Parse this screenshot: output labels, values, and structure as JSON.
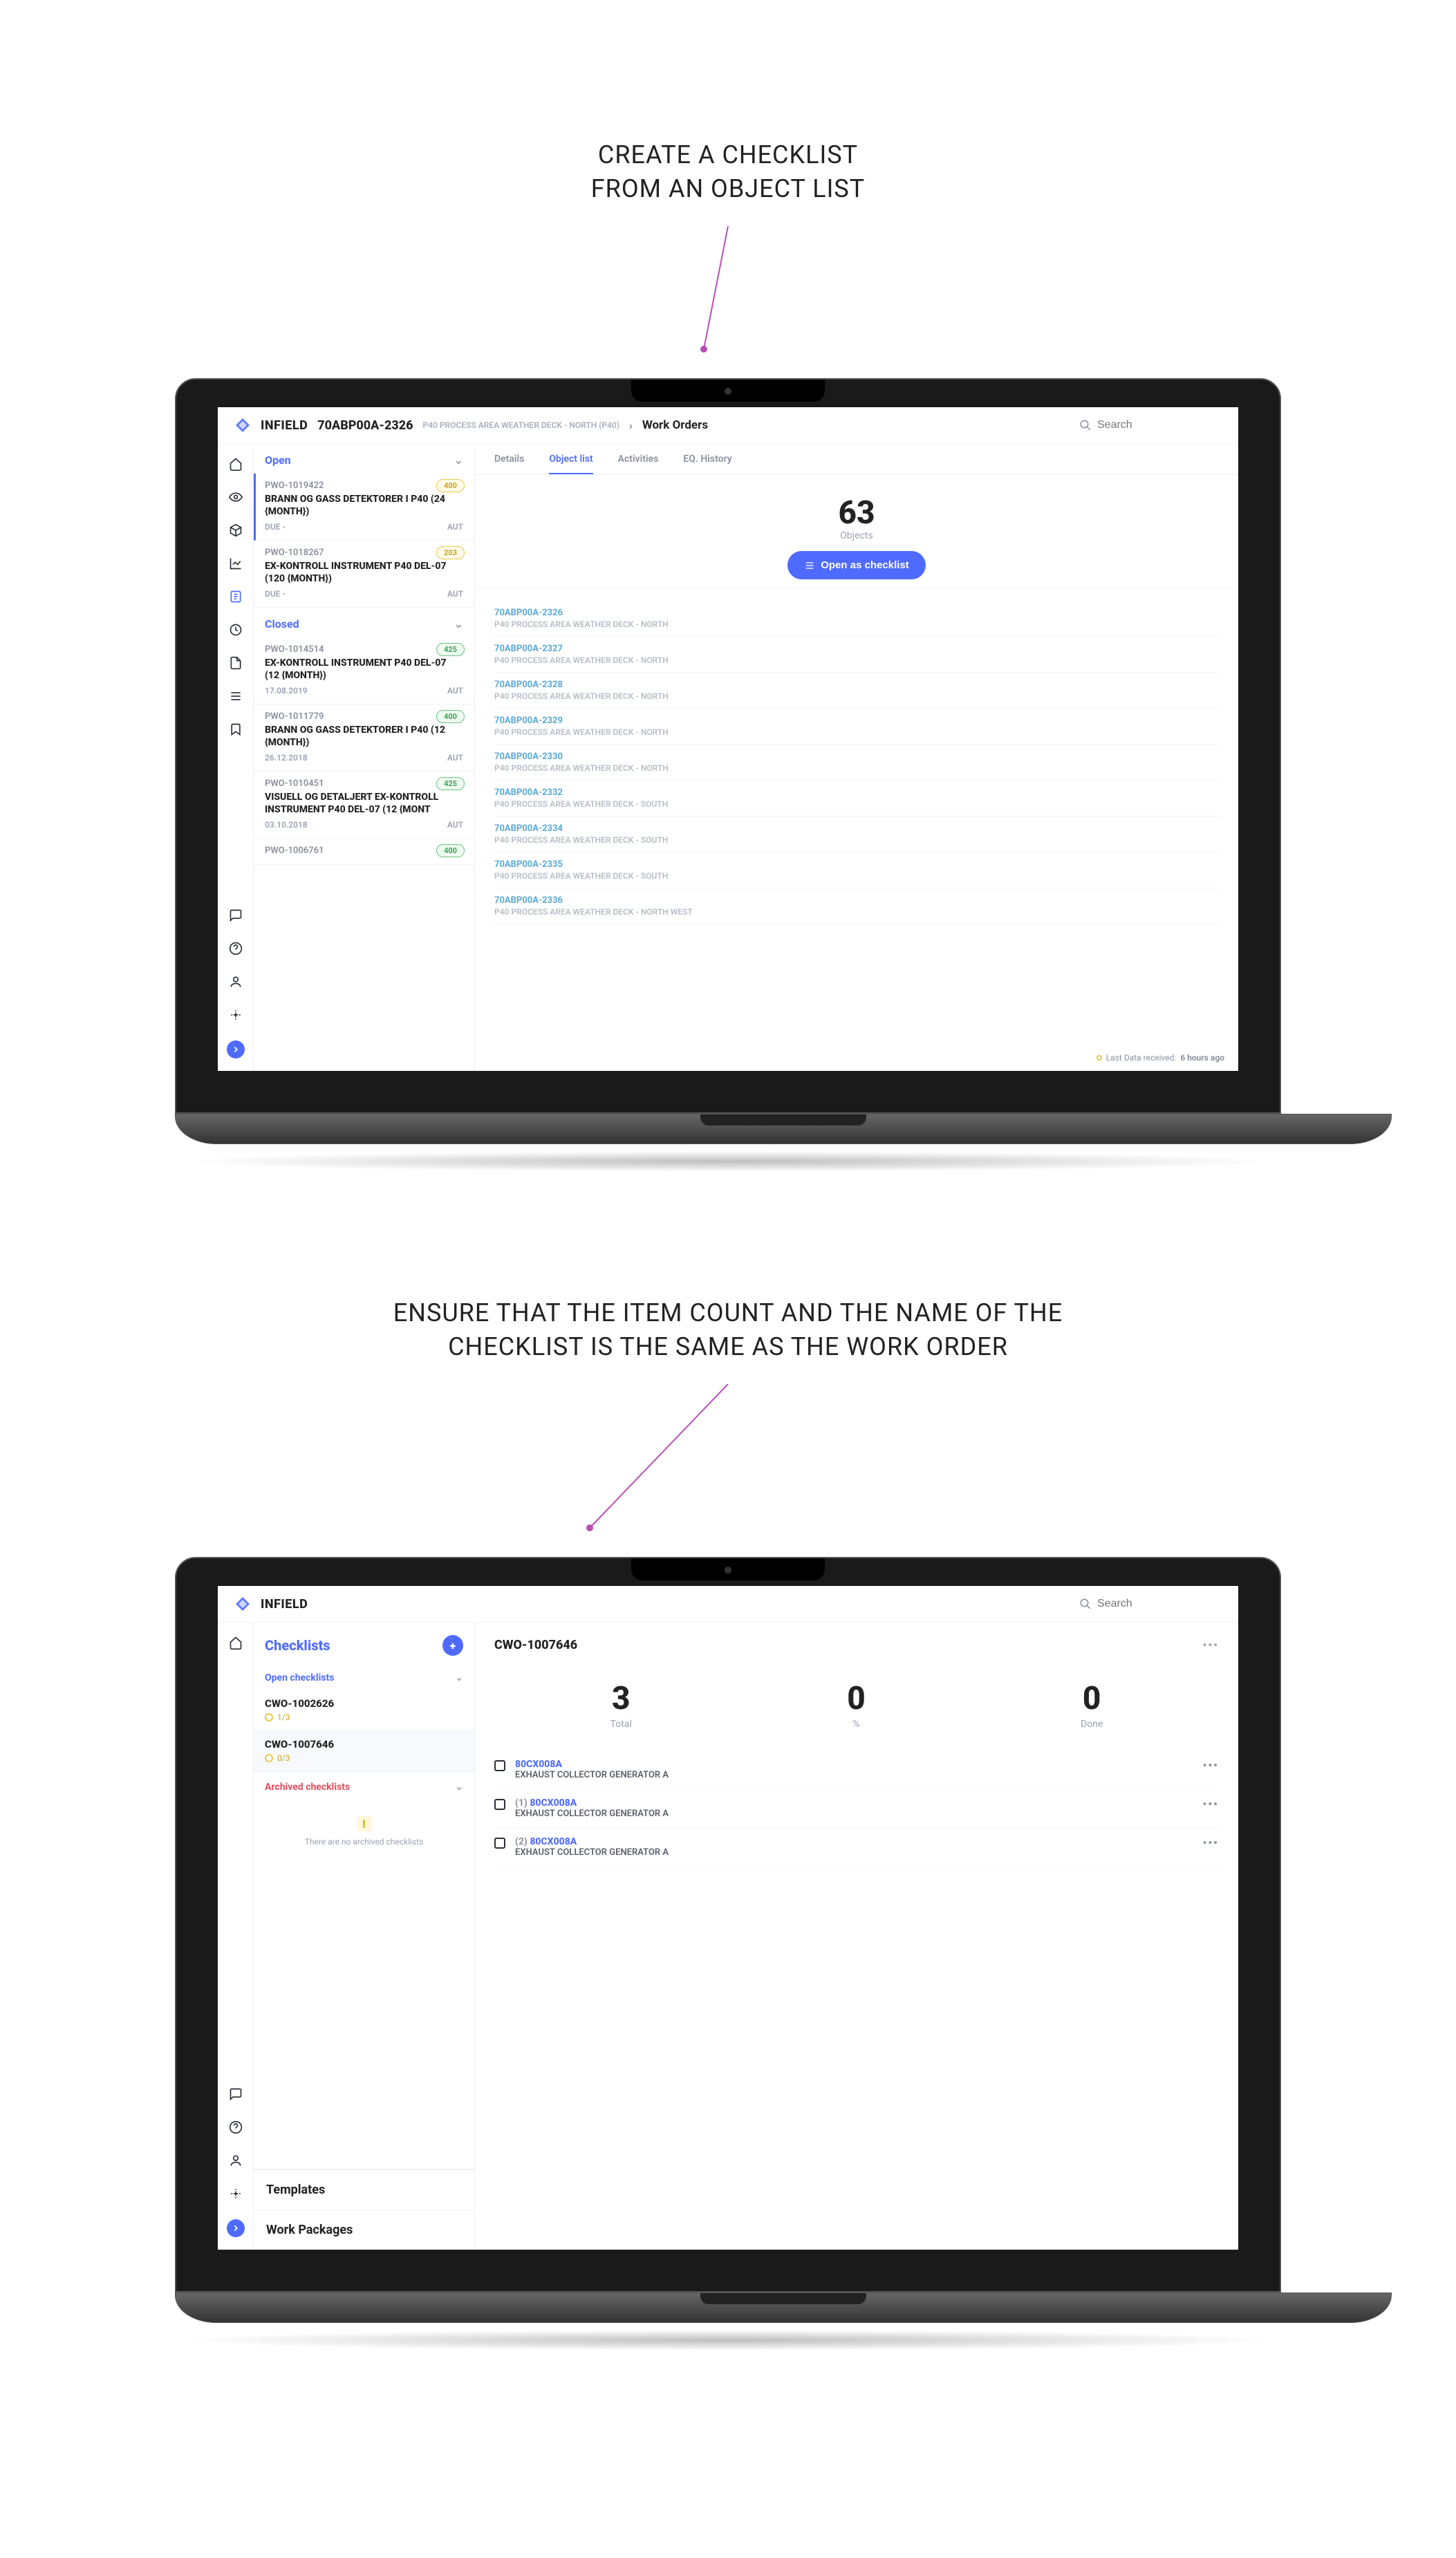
{
  "annotation1": {
    "line1": "CREATE A CHECKLIST",
    "line2": "FROM AN OBJECT LIST"
  },
  "annotation2": {
    "line1": "ENSURE THAT THE ITEM COUNT AND THE NAME OF THE",
    "line2": "CHECKLIST IS THE SAME AS THE WORK ORDER"
  },
  "screen1": {
    "brand": "INFIELD",
    "breadcrumb": {
      "id": "70ABP00A-2326",
      "sub": "P40 PROCESS AREA WEATHER DECK - NORTH (P40)",
      "last": "Work Orders"
    },
    "search_placeholder": "Search",
    "tabs": [
      "Details",
      "Object list",
      "Activities",
      "EQ. History"
    ],
    "active_tab": 1,
    "sections": {
      "open": "Open",
      "closed": "Closed"
    },
    "work_orders_open": [
      {
        "id": "PWO-1019422",
        "title": "BRANN OG GASS DETEKTORER I P40 (24 {MONTH})",
        "due": "DUE -",
        "disc": "AUT",
        "badge": "400",
        "badge_color": "yellow",
        "active": true
      },
      {
        "id": "PWO-1018267",
        "title": "EX-KONTROLL INSTRUMENT P40 DEL-07 (120 {MONTH})",
        "due": "DUE -",
        "disc": "AUT",
        "badge": "203",
        "badge_color": "yellow"
      }
    ],
    "work_orders_closed": [
      {
        "id": "PWO-1014514",
        "title": "EX-KONTROLL INSTRUMENT P40 DEL-07 (12 {MONTH})",
        "due": "17.08.2019",
        "disc": "AUT",
        "badge": "425",
        "badge_color": "green"
      },
      {
        "id": "PWO-1011779",
        "title": "BRANN OG GASS DETEKTORER I P40 (12 {MONTH})",
        "due": "26.12.2018",
        "disc": "AUT",
        "badge": "400",
        "badge_color": "green"
      },
      {
        "id": "PWO-1010451",
        "title": "VISUELL OG DETALJERT EX-KONTROLL INSTRUMENT P40 DEL-07 (12 {MONT",
        "due": "03.10.2018",
        "disc": "AUT",
        "badge": "425",
        "badge_color": "green"
      },
      {
        "id": "PWO-1006761",
        "title": "",
        "due": "",
        "disc": "",
        "badge": "400",
        "badge_color": "green"
      }
    ],
    "object_count": "63",
    "object_label": "Objects",
    "open_checklist_btn": "Open as checklist",
    "objects": [
      {
        "id": "70ABP00A-2326",
        "desc": "P40 PROCESS AREA WEATHER DECK - NORTH"
      },
      {
        "id": "70ABP00A-2327",
        "desc": "P40 PROCESS AREA WEATHER DECK - NORTH"
      },
      {
        "id": "70ABP00A-2328",
        "desc": "P40 PROCESS AREA WEATHER DECK - NORTH"
      },
      {
        "id": "70ABP00A-2329",
        "desc": "P40 PROCESS AREA WEATHER DECK - NORTH"
      },
      {
        "id": "70ABP00A-2330",
        "desc": "P40 PROCESS AREA WEATHER DECK - NORTH"
      },
      {
        "id": "70ABP00A-2332",
        "desc": "P40 PROCESS AREA WEATHER DECK - SOUTH"
      },
      {
        "id": "70ABP00A-2334",
        "desc": "P40 PROCESS AREA WEATHER DECK - SOUTH"
      },
      {
        "id": "70ABP00A-2335",
        "desc": "P40 PROCESS AREA WEATHER DECK - SOUTH"
      },
      {
        "id": "70ABP00A-2336",
        "desc": "P40 PROCESS AREA WEATHER DECK - NORTH WEST"
      }
    ],
    "footer": {
      "label": "Last Data received:",
      "value": "6 hours ago"
    }
  },
  "screen2": {
    "brand": "INFIELD",
    "search_placeholder": "Search",
    "sidebar": {
      "title": "Checklists",
      "open_label": "Open checklists",
      "archived_label": "Archived checklists",
      "open_items": [
        {
          "id": "CWO-1002626",
          "count": "1/3"
        },
        {
          "id": "CWO-1007646",
          "count": "0/3",
          "active": true
        }
      ],
      "archived_empty": "There are no archived checklists",
      "nav": [
        "Templates",
        "Work Packages"
      ]
    },
    "main": {
      "title": "CWO-1007646",
      "stats": [
        {
          "n": "3",
          "l": "Total"
        },
        {
          "n": "0",
          "l": "%"
        },
        {
          "n": "0",
          "l": "Done"
        }
      ],
      "items": [
        {
          "prefix": "",
          "id": "80CX008A",
          "sub": "EXHAUST COLLECTOR GENERATOR A"
        },
        {
          "prefix": "(1) ",
          "id": "80CX008A",
          "sub": "EXHAUST COLLECTOR GENERATOR A"
        },
        {
          "prefix": "(2) ",
          "id": "80CX008A",
          "sub": "EXHAUST COLLECTOR GENERATOR A"
        }
      ]
    }
  }
}
